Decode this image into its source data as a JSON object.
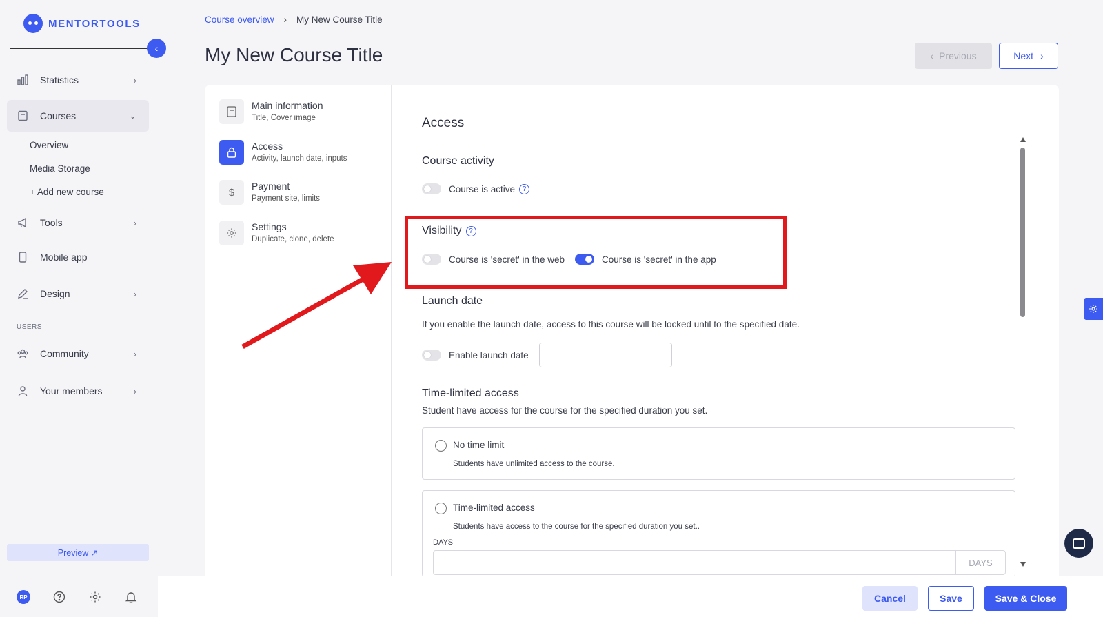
{
  "brand": {
    "name": "MENTORTOOLS"
  },
  "sidebar": {
    "items": [
      {
        "label": "Statistics"
      },
      {
        "label": "Courses"
      },
      {
        "label": "Tools"
      },
      {
        "label": "Mobile app"
      },
      {
        "label": "Design"
      },
      {
        "label": "Community"
      },
      {
        "label": "Your members"
      }
    ],
    "courses_sub": [
      "Overview",
      "Media Storage",
      "+ Add new course"
    ],
    "section_users": "USERS",
    "preview_label": "Preview ↗",
    "avatar_initials": "RP"
  },
  "breadcrumb": {
    "parent": "Course overview",
    "current": "My New Course Title"
  },
  "page_title": "My New Course Title",
  "nav_buttons": {
    "previous": "Previous",
    "next": "Next"
  },
  "steps": [
    {
      "title": "Main information",
      "sub": "Title, Cover image"
    },
    {
      "title": "Access",
      "sub": "Activity, launch date, inputs"
    },
    {
      "title": "Payment",
      "sub": "Payment site, limits"
    },
    {
      "title": "Settings",
      "sub": "Duplicate, clone, delete"
    }
  ],
  "access": {
    "heading": "Access",
    "course_activity": {
      "heading": "Course activity",
      "toggle_label": "Course is active",
      "active": false
    },
    "visibility": {
      "heading": "Visibility",
      "web_label": "Course is 'secret' in the web",
      "web_on": false,
      "app_label": "Course is 'secret' in the app",
      "app_on": true
    },
    "launch_date": {
      "heading": "Launch date",
      "description": "If you enable the launch date, access to this course will be locked until to the specified date.",
      "toggle_label": "Enable launch date",
      "value": ""
    },
    "time_limited": {
      "heading": "Time-limited access",
      "description": "Student have access for the course for the specified duration you set.",
      "options": [
        {
          "title": "No time limit",
          "sub": "Students have unlimited access to the course."
        },
        {
          "title": "Time-limited access",
          "sub": "Students have access to the course for the specified duration you set.."
        }
      ],
      "days_label": "DAYS",
      "days_suffix": "DAYS",
      "days_value": ""
    }
  },
  "footer": {
    "cancel": "Cancel",
    "save": "Save",
    "save_close": "Save & Close"
  },
  "colors": {
    "accent": "#3d5af1",
    "annotation": "#e2191c"
  }
}
